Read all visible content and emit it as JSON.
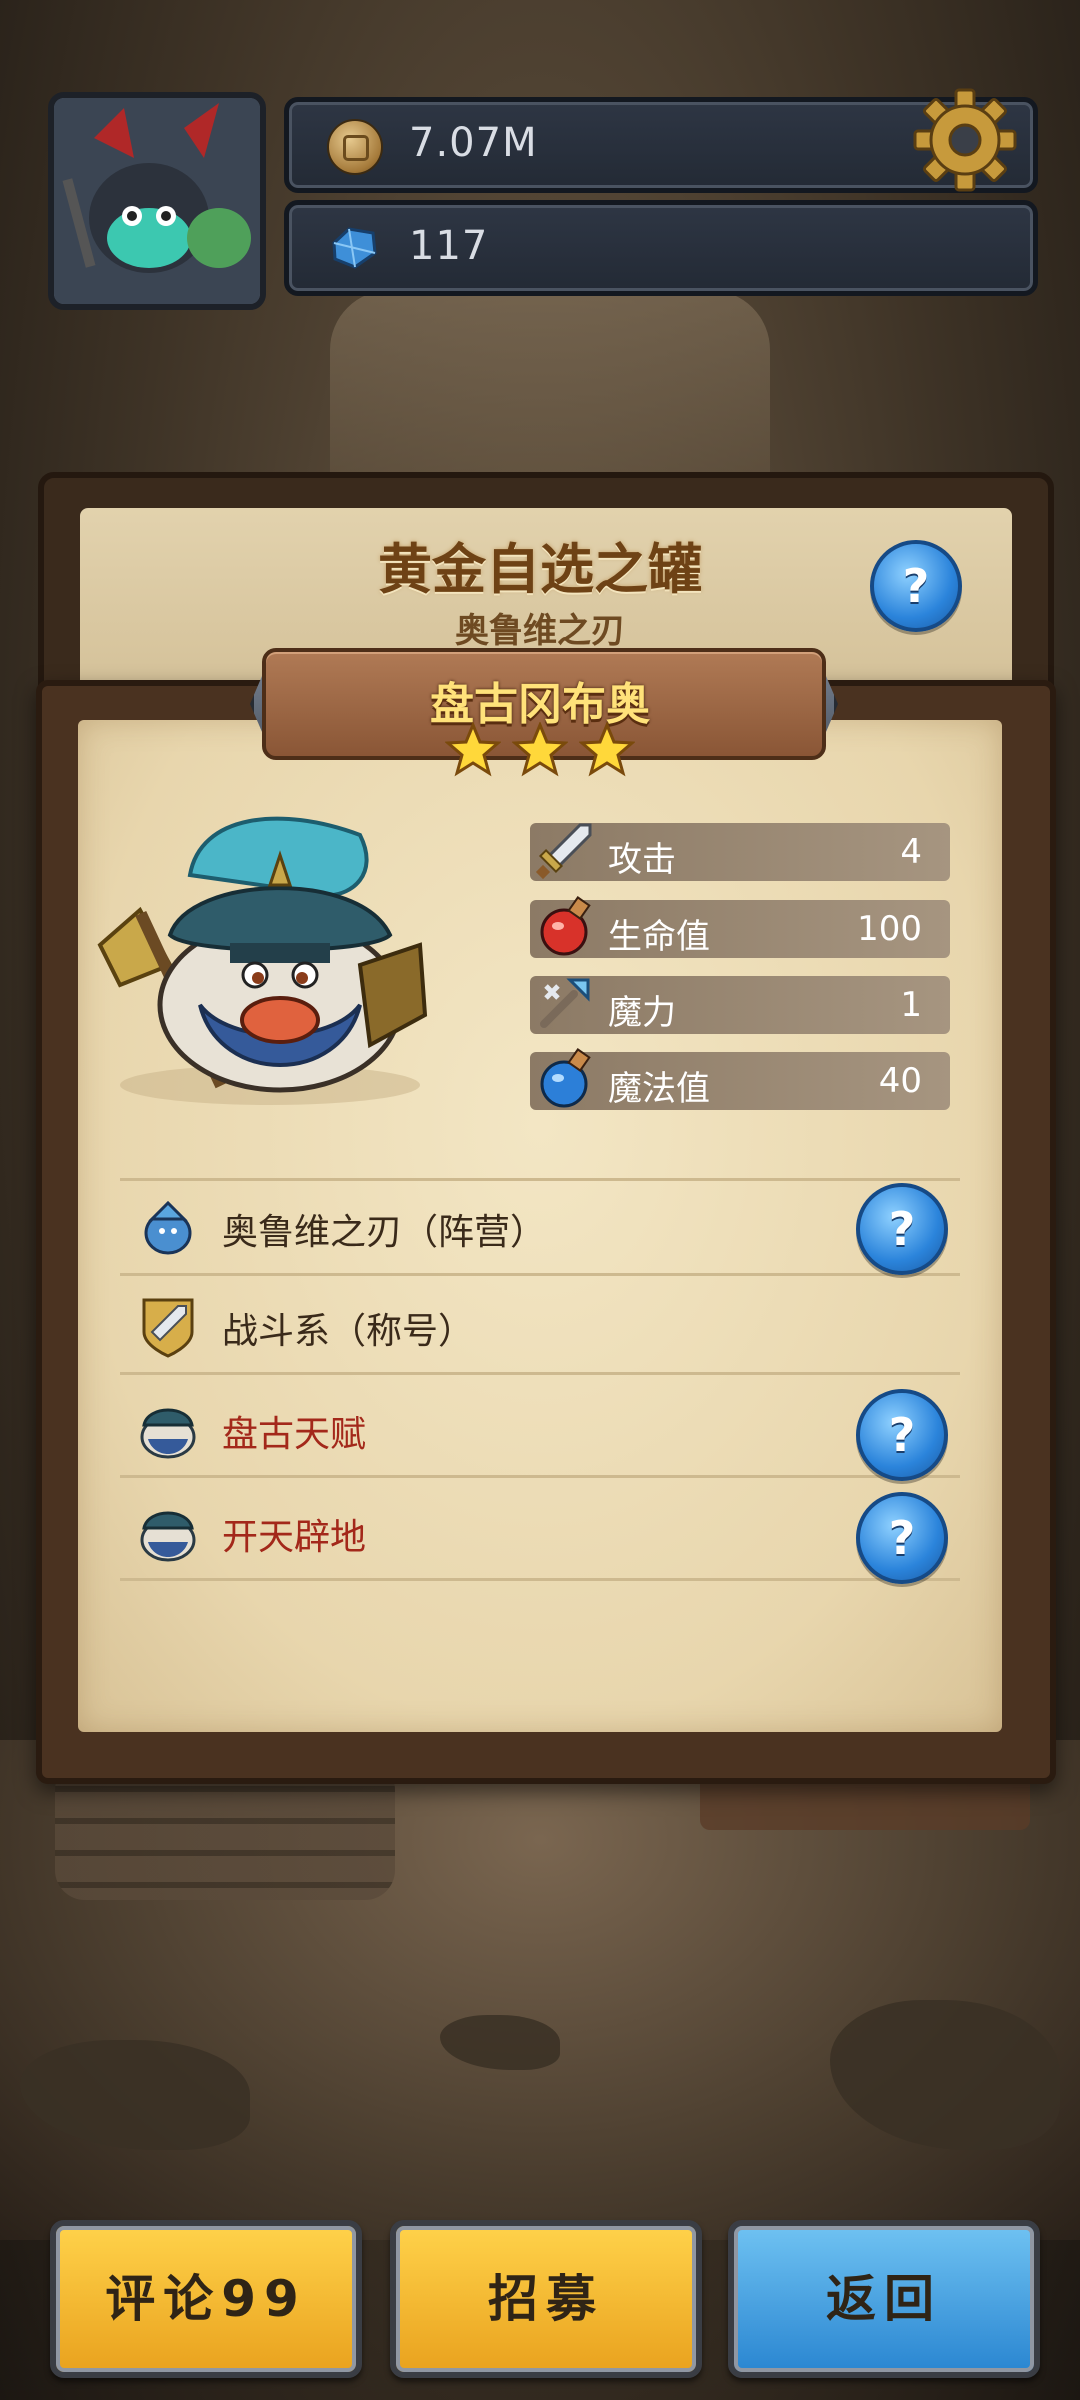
{
  "hud": {
    "gold": "7.07M",
    "gems": "117"
  },
  "dialog": {
    "title": "黄金自选之罐",
    "subtitle": "奥鲁维之刃"
  },
  "hero": {
    "name": "盘古冈布奥",
    "stars": 3,
    "max_stars": 3,
    "stats": [
      {
        "icon": "sword-icon",
        "label": "攻击",
        "value": "4"
      },
      {
        "icon": "health-potion-icon",
        "label": "生命值",
        "value": "100"
      },
      {
        "icon": "magic-wand-icon",
        "label": "魔力",
        "value": "1"
      },
      {
        "icon": "mana-potion-icon",
        "label": "魔法值",
        "value": "40"
      }
    ],
    "traits": [
      {
        "icon": "faction-icon",
        "text": "奥鲁维之刃（阵营）",
        "red": false,
        "help": true
      },
      {
        "icon": "battle-badge-icon",
        "text": "战斗系（称号）",
        "red": false,
        "help": false
      },
      {
        "icon": "pangu-talent-icon",
        "text": "盘古天赋",
        "red": true,
        "help": true
      },
      {
        "icon": "pangu-skill-icon",
        "text": "开天辟地",
        "red": true,
        "help": true
      }
    ]
  },
  "buttons": {
    "comment": "评论99",
    "recruit": "招募",
    "back": "返回"
  },
  "help_glyph": "?",
  "colors": {
    "gold_button": "#f5b833",
    "blue_button": "#3f9be0",
    "title_brown": "#6e4215",
    "trait_red": "#a3281a"
  }
}
